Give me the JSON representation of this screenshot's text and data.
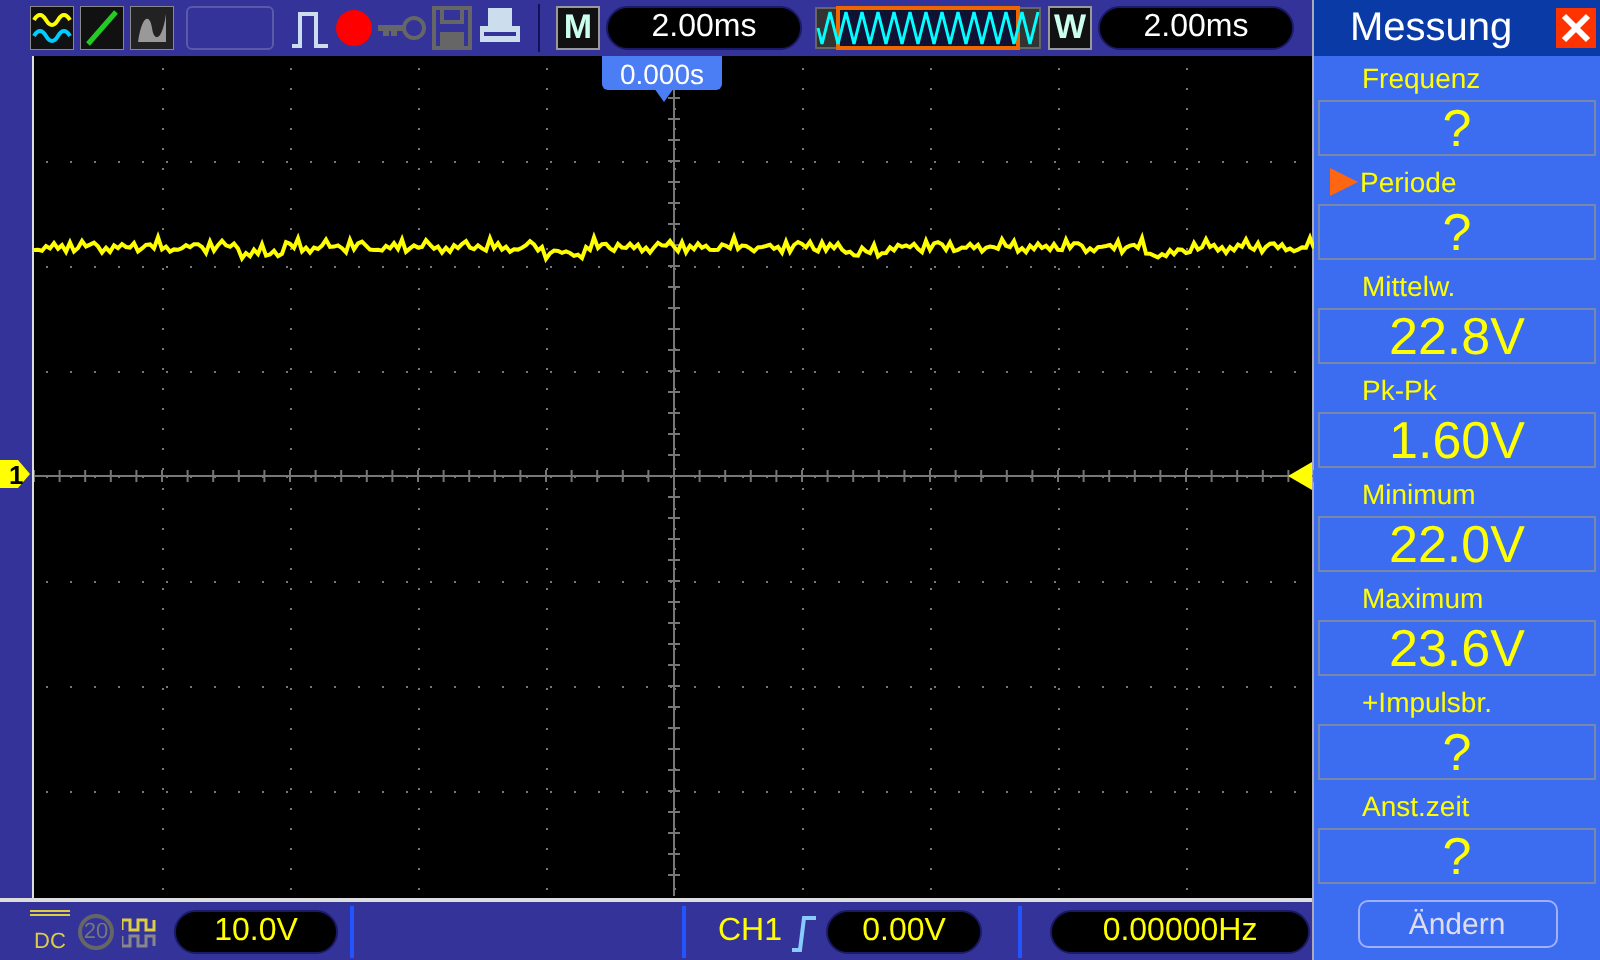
{
  "toolbar": {
    "recording": true,
    "menu_key": "M",
    "time_base": "2.00ms",
    "window_key": "W",
    "window_time_base": "2.00ms"
  },
  "scope": {
    "trigger_position": "0.000s",
    "channel_marker": "1"
  },
  "measurements": {
    "title": "Messung",
    "items": [
      {
        "label": "Frequenz",
        "value": "?",
        "selected": false
      },
      {
        "label": "Periode",
        "value": "?",
        "selected": true
      },
      {
        "label": "Mittelw.",
        "value": "22.8V",
        "selected": false
      },
      {
        "label": "Pk-Pk",
        "value": "1.60V",
        "selected": false
      },
      {
        "label": "Minimum",
        "value": "22.0V",
        "selected": false
      },
      {
        "label": "Maximum",
        "value": "23.6V",
        "selected": false
      },
      {
        "label": "+Impulsbr.",
        "value": "?",
        "selected": false
      },
      {
        "label": "Anst.zeit",
        "value": "?",
        "selected": false
      }
    ],
    "button": "Ändern"
  },
  "status_bar": {
    "coupling": "DC",
    "bandwidth_limit": "20",
    "volts_per_div": "10.0V",
    "trigger_source": "CH1",
    "trigger_level": "0.00V",
    "frequency": "0.00000Hz"
  }
}
